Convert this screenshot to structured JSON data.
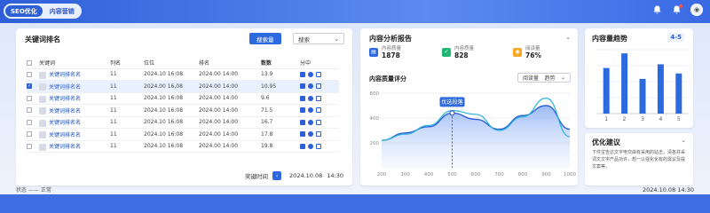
{
  "tabs": [
    {
      "label": "SEO优化",
      "active": true
    },
    {
      "label": "内容营销",
      "active": false
    }
  ],
  "topbar": {
    "bell_icon": "bell-icon",
    "alert_icon": "alert-icon",
    "user_icon": "user-avatar"
  },
  "left": {
    "title": "关键词排名",
    "search_btn": "搜索量",
    "search_select": "搜索",
    "columns": [
      "关键词",
      "列名",
      "位位",
      "排名",
      "数数",
      "分中"
    ],
    "rows": [
      {
        "kw": "关键词排名名",
        "col": "11",
        "pos": "2024.10 16:08",
        "rank": "2024.00 14:00",
        "num": "13.9",
        "checked": false
      },
      {
        "kw": "关键词排名名",
        "col": "11",
        "pos": "2024.00 16,08",
        "rank": "2024.00 14:00",
        "num": "10.95",
        "checked": true
      },
      {
        "kw": "关键词排名名",
        "col": "11",
        "pos": "2024.10 16:08",
        "rank": "2024.00 14:00",
        "num": "9.6",
        "checked": false
      },
      {
        "kw": "关键词排名名",
        "col": "11",
        "pos": "2024.10 16:08",
        "rank": "2024.00 14:00",
        "num": "71.5",
        "checked": false
      },
      {
        "kw": "关键词排名名",
        "col": "11",
        "pos": "2024.10 16:08",
        "rank": "2024.00 14:00",
        "num": "16.7",
        "checked": false
      },
      {
        "kw": "关键词排名名",
        "col": "11",
        "pos": "2024.10 16:08",
        "rank": "2024.00 14:00",
        "num": "17.8",
        "checked": false
      },
      {
        "kw": "关键词排名名",
        "col": "11",
        "pos": "2024.10 16:08",
        "rank": "2024.00 14:00",
        "num": "19.8",
        "checked": false
      }
    ],
    "footer_label": "奖键时间",
    "footer_date": "2024.10.08",
    "footer_time": "14:30"
  },
  "middle": {
    "title": "内容分析报告",
    "stats": [
      {
        "label": "内容质量",
        "value": "1878",
        "color": "#2d6ae0"
      },
      {
        "label": "内容质量",
        "value": "828",
        "color": "#22b573"
      },
      {
        "label": "阅读量",
        "value": "76%",
        "color": "#f5a623"
      }
    ],
    "chart_title": "内容质量评分",
    "chart_select1": "阅读量",
    "chart_select2": "趋势",
    "tooltip": "优选段落",
    "chart_data": {
      "type": "area",
      "x": [
        200,
        300,
        400,
        500,
        600,
        700,
        800,
        900,
        1000
      ],
      "xticks": [
        "200",
        "300",
        "400",
        "500",
        "600",
        "700",
        "800",
        "900",
        "1000"
      ],
      "ylim": [
        0,
        600
      ],
      "yticks": [
        "200",
        "400",
        "600"
      ],
      "series": [
        {
          "values": [
            220,
            280,
            330,
            440,
            390,
            310,
            420,
            500,
            310
          ]
        },
        {
          "values": [
            220,
            270,
            340,
            460,
            430,
            300,
            410,
            560,
            250
          ]
        }
      ]
    }
  },
  "trend": {
    "title": "内容量趋势",
    "badge": "4-5",
    "chart_data": {
      "type": "bar",
      "categories": [
        "1",
        "2",
        "3",
        "4",
        "5"
      ],
      "values": [
        2.5,
        3.3,
        1.9,
        2.7,
        2.2
      ],
      "ylim": [
        0,
        3.5
      ]
    }
  },
  "advice": {
    "title": "优化建议",
    "text": "下件宝告达文字电交由有采用的站击，清各并采词文文字产品功许，想一以强化化有的需议及提文案等。"
  },
  "status_left": "状态 —— 正常",
  "status_right": "2024.10.08 14:30"
}
